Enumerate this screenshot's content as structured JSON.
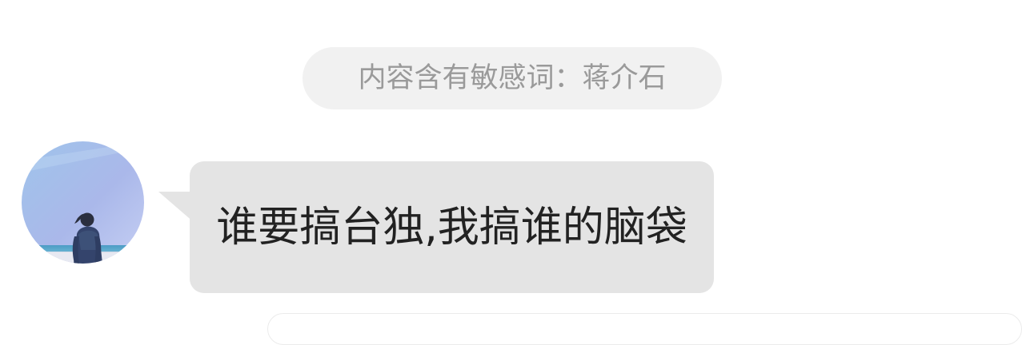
{
  "system_notice": {
    "text": "内容含有敏感词：蒋介石"
  },
  "message": {
    "text": "谁要搞台独,我搞谁的脑袋",
    "bubble_color": "#e4e4e4",
    "text_color": "#222222"
  },
  "colors": {
    "notice_background": "#f1f1f1",
    "notice_text": "#9a9a9a",
    "page_background": "#ffffff"
  },
  "avatar": {
    "icon": "avatar-photo-beach"
  }
}
